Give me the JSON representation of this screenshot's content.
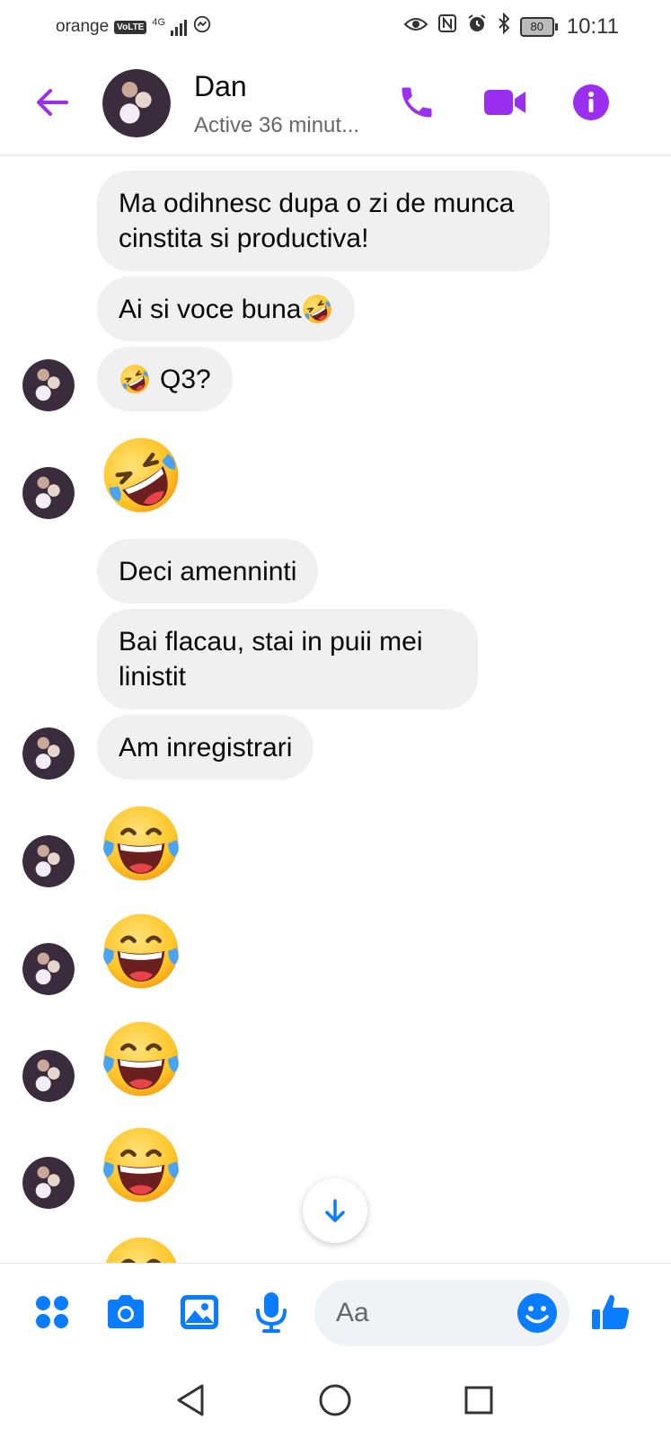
{
  "status_bar": {
    "carrier": "orange",
    "volte": "VoLTE",
    "network": "4G",
    "battery": "80",
    "time": "10:11"
  },
  "header": {
    "contact_name": "Dan",
    "contact_status": "Active 36 minut..."
  },
  "messages": [
    {
      "text": "Ma odihnesc dupa o zi de munca cinstita si productiva!"
    },
    {
      "text": "Ai si voce buna"
    },
    {
      "text": "Q3?"
    },
    {
      "text": "Deci amenninti"
    },
    {
      "text": "Bai flacau, stai in puii mei linistit"
    },
    {
      "text": "Am inregistrari"
    }
  ],
  "composer": {
    "placeholder": "Aa"
  },
  "colors": {
    "accent": "#9b2ff0",
    "composer_blue": "#0a7cff",
    "bubble": "#f0f0f0",
    "emoji_yellow": "#ffc93c"
  },
  "icons": [
    "back-arrow-icon",
    "phone-icon",
    "video-icon",
    "info-icon",
    "scroll-down-arrow-icon",
    "apps-icon",
    "camera-icon",
    "gallery-icon",
    "microphone-icon",
    "emoji-icon",
    "thumbs-up-icon",
    "nav-back-icon",
    "nav-home-icon",
    "nav-recents-icon"
  ]
}
